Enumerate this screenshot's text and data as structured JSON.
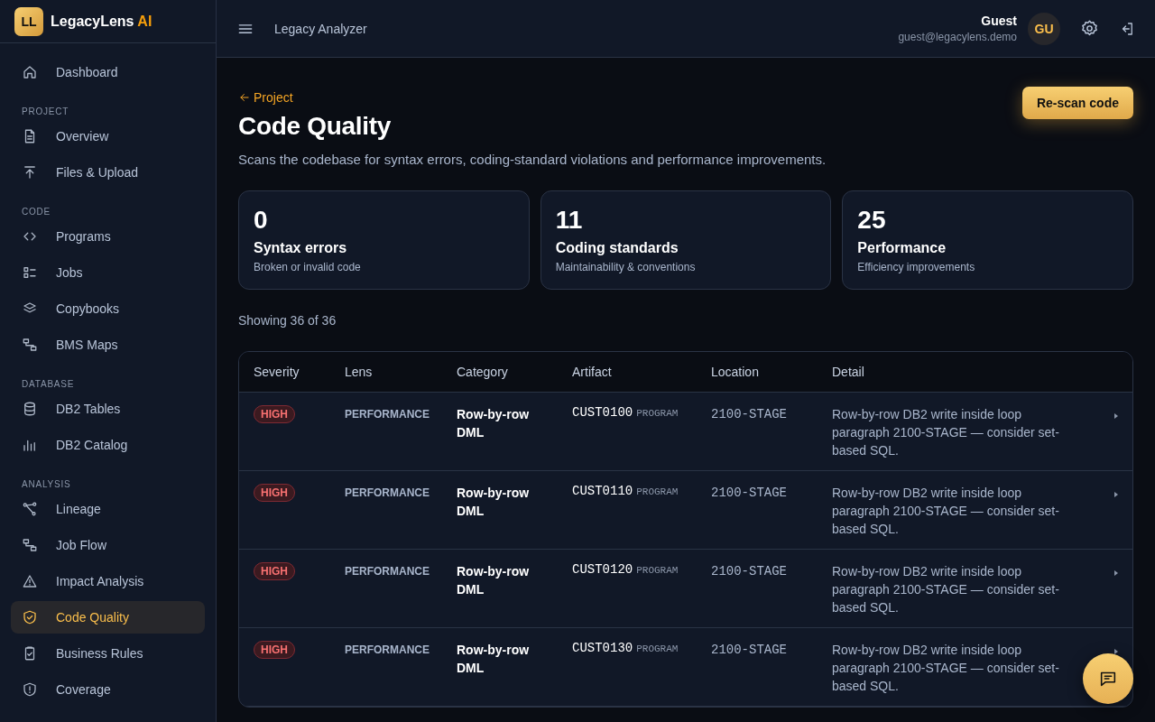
{
  "brand": {
    "badge": "LL",
    "name": "LegacyLens",
    "accent": "AI"
  },
  "sidebar": {
    "sections": [
      {
        "items": [
          {
            "label": "Dashboard",
            "selected": false
          }
        ]
      },
      {
        "title": "PROJECT",
        "items": [
          {
            "label": "Overview",
            "selected": false
          },
          {
            "label": "Files & Upload",
            "selected": false
          }
        ]
      },
      {
        "title": "CODE",
        "items": [
          {
            "label": "Programs",
            "selected": false
          },
          {
            "label": "Jobs",
            "selected": false
          },
          {
            "label": "Copybooks",
            "selected": false
          },
          {
            "label": "BMS Maps",
            "selected": false
          }
        ]
      },
      {
        "title": "DATABASE",
        "items": [
          {
            "label": "DB2 Tables",
            "selected": false
          },
          {
            "label": "DB2 Catalog",
            "selected": false
          }
        ]
      },
      {
        "title": "ANALYSIS",
        "items": [
          {
            "label": "Lineage",
            "selected": false
          },
          {
            "label": "Job Flow",
            "selected": false
          },
          {
            "label": "Impact Analysis",
            "selected": false
          },
          {
            "label": "Code Quality",
            "selected": true
          },
          {
            "label": "Business Rules",
            "selected": false
          },
          {
            "label": "Coverage",
            "selected": false
          }
        ]
      }
    ]
  },
  "header": {
    "title": "Legacy Analyzer",
    "user": {
      "name": "Guest",
      "email": "guest@legacylens.demo",
      "initials": "GU"
    }
  },
  "page": {
    "back_link": "Project",
    "title": "Code Quality",
    "description": "Scans the codebase for syntax errors, coding-standard violations and performance improvements.",
    "action": "Re-scan code"
  },
  "stats": [
    {
      "value": "0",
      "label": "Syntax errors",
      "caption": "Broken or invalid code"
    },
    {
      "value": "11",
      "label": "Coding standards",
      "caption": "Maintainability & conventions"
    },
    {
      "value": "25",
      "label": "Performance",
      "caption": "Efficiency improvements"
    }
  ],
  "showing": "Showing 36 of 36",
  "table": {
    "columns": [
      "Severity",
      "Lens",
      "Category",
      "Artifact",
      "Location",
      "Detail"
    ],
    "rows": [
      {
        "severity": "HIGH",
        "lens": "PERFORMANCE",
        "category": "Row-by-row DML",
        "artifact": "CUST0100",
        "artifact_type": "PROGRAM",
        "location": "2100-STAGE",
        "detail": "Row-by-row DB2 write inside loop paragraph 2100-STAGE — consider set-based SQL."
      },
      {
        "severity": "HIGH",
        "lens": "PERFORMANCE",
        "category": "Row-by-row DML",
        "artifact": "CUST0110",
        "artifact_type": "PROGRAM",
        "location": "2100-STAGE",
        "detail": "Row-by-row DB2 write inside loop paragraph 2100-STAGE — consider set-based SQL."
      },
      {
        "severity": "HIGH",
        "lens": "PERFORMANCE",
        "category": "Row-by-row DML",
        "artifact": "CUST0120",
        "artifact_type": "PROGRAM",
        "location": "2100-STAGE",
        "detail": "Row-by-row DB2 write inside loop paragraph 2100-STAGE — consider set-based SQL."
      },
      {
        "severity": "HIGH",
        "lens": "PERFORMANCE",
        "category": "Row-by-row DML",
        "artifact": "CUST0130",
        "artifact_type": "PROGRAM",
        "location": "2100-STAGE",
        "detail": "Row-by-row DB2 write inside loop paragraph 2100-STAGE — consider set-based SQL."
      }
    ]
  }
}
